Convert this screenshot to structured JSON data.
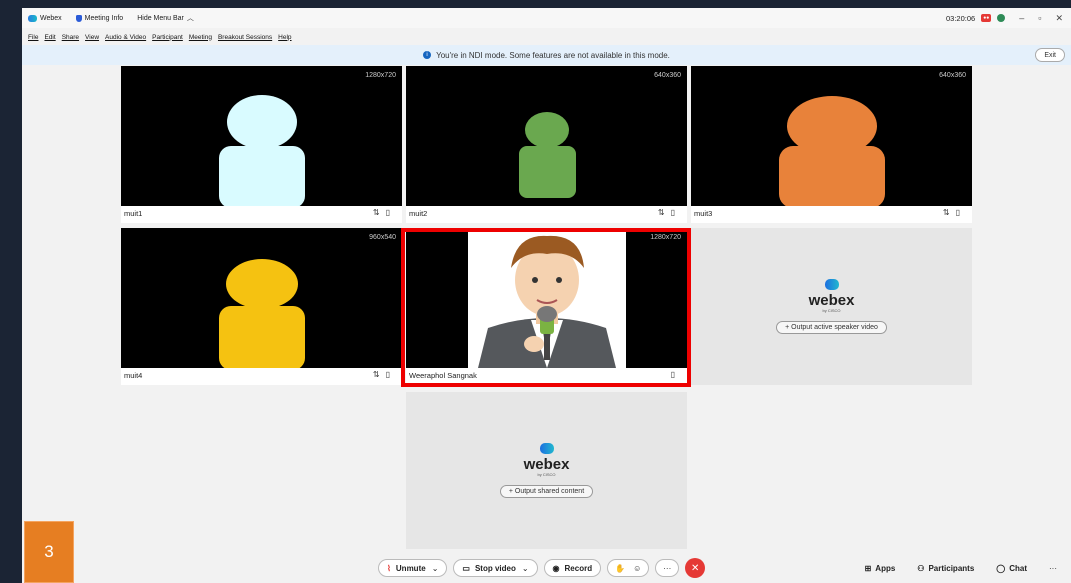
{
  "titlebar": {
    "app_name": "Webex",
    "meeting_info": "Meeting Info",
    "hide_menu": "Hide Menu Bar",
    "time": "03:20:06"
  },
  "menu": [
    "File",
    "Edit",
    "Share",
    "View",
    "Audio & Video",
    "Participant",
    "Meeting",
    "Breakout Sessions",
    "Help"
  ],
  "banner": {
    "text": "You're in NDI mode. Some features are not available in this mode.",
    "exit": "Exit"
  },
  "tiles": [
    {
      "name": "muit1",
      "res": "1280x720",
      "color": "#d9fbff"
    },
    {
      "name": "muit2",
      "res": "640x360",
      "color": "#6aa84f"
    },
    {
      "name": "muit3",
      "res": "640x360",
      "color": "#e8823a"
    },
    {
      "name": "muit4",
      "res": "960x540",
      "color": "#f5c211"
    },
    {
      "name": "Weeraphol Sangnak",
      "res": "1280x720"
    }
  ],
  "empty_tiles": {
    "brand": "webex",
    "by": "by CISCO",
    "active_speaker": "+ Output active speaker video",
    "shared_content": "+ Output shared content"
  },
  "controls": {
    "unmute": "Unmute",
    "stop_video": "Stop video",
    "record": "Record",
    "apps": "Apps",
    "participants": "Participants",
    "chat": "Chat"
  },
  "step": "3"
}
